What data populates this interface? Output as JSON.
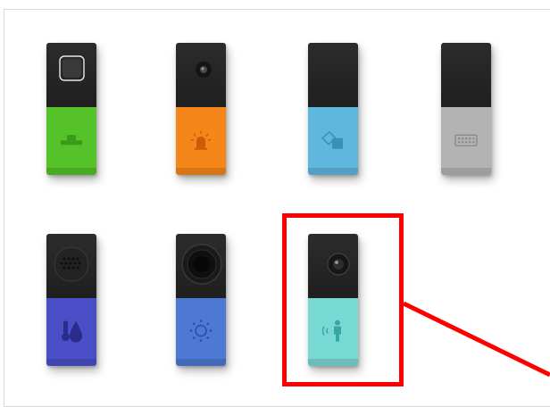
{
  "scene": {
    "background": "#ffffff",
    "annotation_color": "#ff0000"
  },
  "blocks": [
    {
      "id": "button",
      "top_feature": "button-square-icon",
      "bottom_color": "#56c22a",
      "symbol": "button-press-icon"
    },
    {
      "id": "led",
      "top_feature": "led-lens-icon",
      "bottom_color": "#f5871a",
      "symbol": "alarm-light-icon"
    },
    {
      "id": "gpio",
      "top_feature": "none",
      "bottom_color": "#5fb7dd",
      "symbol": "gpio-connect-icon"
    },
    {
      "id": "keyboard",
      "top_feature": "none",
      "bottom_color": "#b3b3b3",
      "symbol": "keyboard-icon"
    },
    {
      "id": "temp-humidity",
      "top_feature": "sensor-grille-icon",
      "bottom_color": "#4a4fc8",
      "symbol": "thermo-drop-icon"
    },
    {
      "id": "brightness",
      "top_feature": "dome-sensor-icon",
      "bottom_color": "#4d79d3",
      "symbol": "sun-icon"
    },
    {
      "id": "motion",
      "top_feature": "pir-lens-icon",
      "bottom_color": "#78d8d4",
      "symbol": "person-motion-icon",
      "highlighted": true
    }
  ]
}
